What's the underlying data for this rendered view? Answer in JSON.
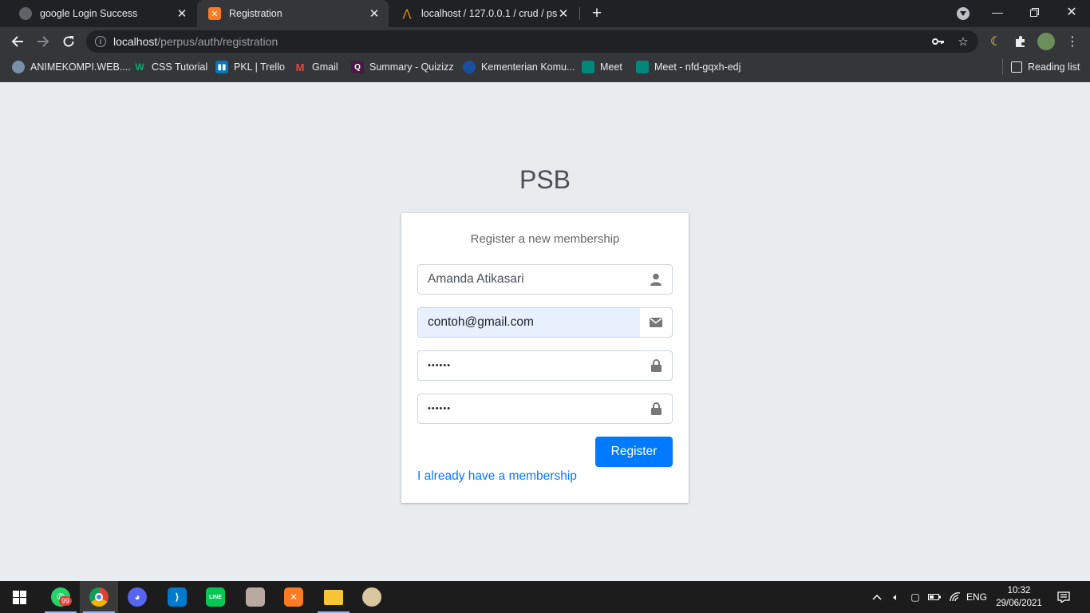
{
  "browser": {
    "tabs": [
      {
        "title": "google Login Success",
        "icon": "globe-icon"
      },
      {
        "title": "Registration",
        "icon": "xampp-icon",
        "active": true
      },
      {
        "title": "localhost / 127.0.0.1 / crud / psb",
        "icon": "phpmyadmin-icon"
      }
    ],
    "url_host": "localhost",
    "url_path": "/perpus/auth/registration",
    "bookmarks": [
      "ANIMEKOMPI.WEB....",
      "CSS Tutorial",
      "PKL | Trello",
      "Gmail",
      "Summary - Quizizz",
      "Kementerian Komu...",
      "Meet",
      "Meet - nfd-gqxh-edj"
    ],
    "reading_list": "Reading list"
  },
  "page": {
    "brand": "PSB",
    "card_message": "Register a new membership",
    "fullname_value": "Amanda Atikasari",
    "email_value": "contoh@gmail.com",
    "password_mask": "••••••",
    "retype_mask": "••••••",
    "register_button": "Register",
    "login_link": "I already have a membership",
    "colors": {
      "primary": "#007bff",
      "background": "#e9ecef",
      "autofill": "#e8f0fe"
    }
  },
  "taskbar": {
    "whatsapp_badge": "99",
    "language": "ENG",
    "time": "10:32",
    "date": "29/06/2021"
  }
}
